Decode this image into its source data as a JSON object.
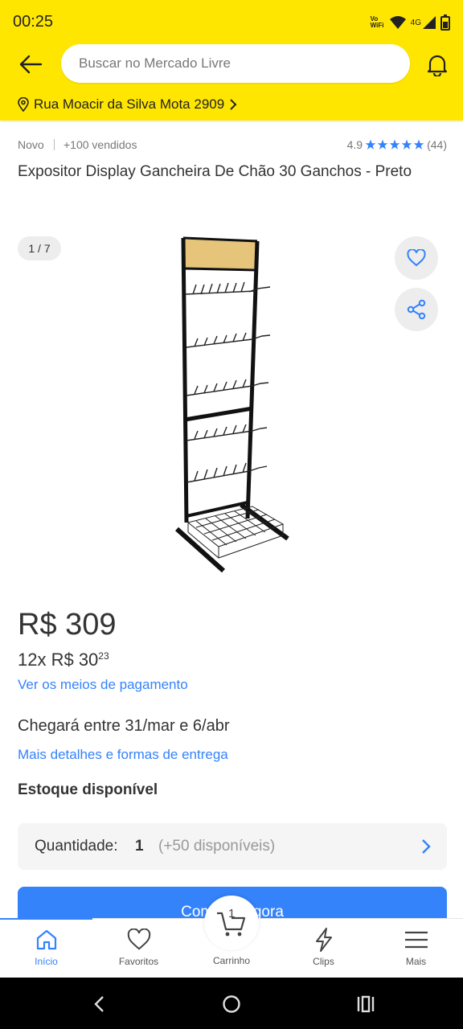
{
  "status_bar": {
    "time": "00:25",
    "vowifi": "Vo WiFi",
    "network": "4G",
    "icons": [
      "vowifi-icon",
      "wifi-icon",
      "signal-icon",
      "battery-icon"
    ]
  },
  "header": {
    "search_placeholder": "Buscar no Mercado Livre",
    "address": "Rua Moacir da Silva Mota 2909",
    "background_color": "#ffe600"
  },
  "product": {
    "condition": "Novo",
    "sold": "+100 vendidos",
    "rating": "4.9",
    "stars": 5,
    "reviews": "(44)",
    "title": "Expositor Display Gancheira De Chão 30 Ganchos - Preto",
    "image_counter": "1 / 7",
    "price": "R$ 309",
    "installments_prefix": "12x R$ 30",
    "installments_cents": "23",
    "payment_link": "Ver os meios de pagamento",
    "delivery": "Chegará entre 31/mar e 6/abr",
    "delivery_link": "Mais detalhes e formas de entrega",
    "stock": "Estoque disponível",
    "quantity_label": "Quantidade:",
    "quantity_value": "1",
    "quantity_available": "(+50 disponíveis)",
    "buy_button": "Comprar agora"
  },
  "tabbar": {
    "active": "Início",
    "items": [
      {
        "label": "Início",
        "icon": "home-icon"
      },
      {
        "label": "Favoritos",
        "icon": "heart-icon"
      },
      {
        "label": "Carrinho",
        "icon": "cart-icon",
        "badge": "1"
      },
      {
        "label": "Clips",
        "icon": "lightning-icon"
      },
      {
        "label": "Mais",
        "icon": "menu-icon"
      }
    ]
  },
  "colors": {
    "accent": "#3483fa",
    "brand_yellow": "#ffe600",
    "text": "#333333"
  }
}
